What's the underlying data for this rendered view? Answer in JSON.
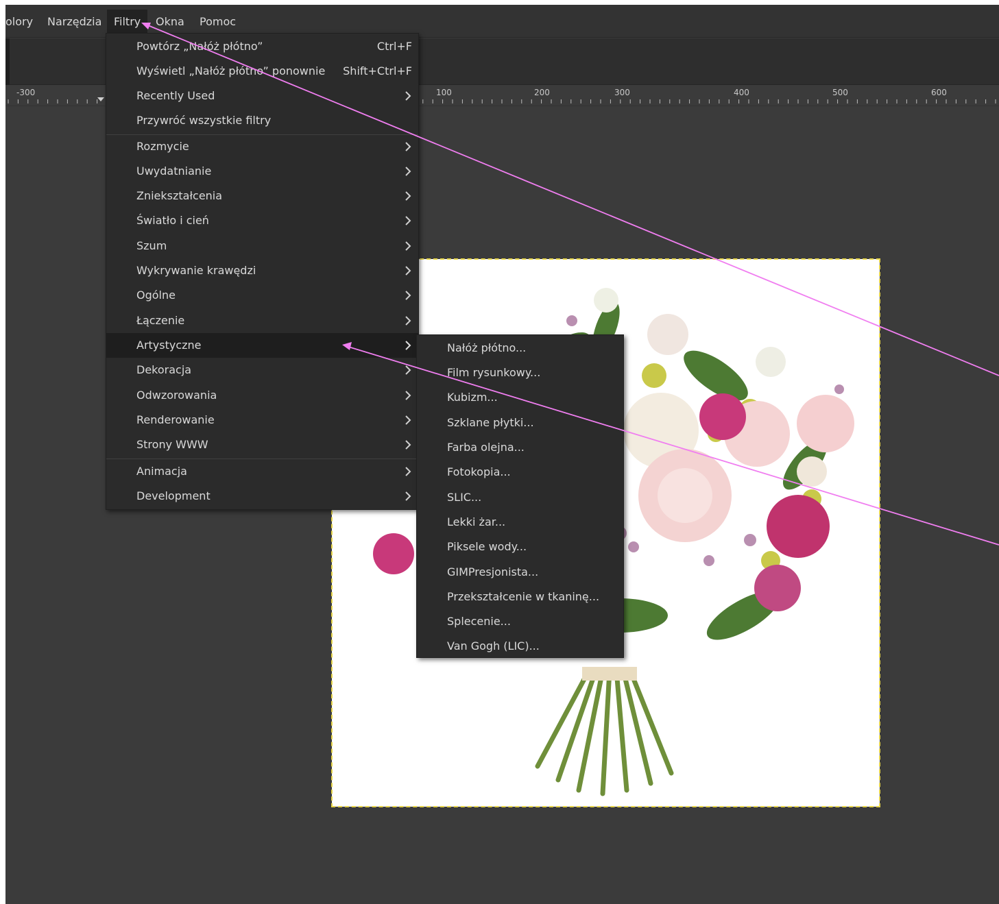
{
  "menubar": {
    "items": [
      "olory",
      "Narzędzia",
      "Filtry",
      "Okna",
      "Pomoc"
    ]
  },
  "ruler": {
    "labels": [
      "-300",
      "100",
      "200",
      "300",
      "400",
      "500",
      "600"
    ]
  },
  "filters_menu": {
    "items": [
      {
        "label": "Powtórz „Nałóż płótno”",
        "shortcut": "Ctrl+F"
      },
      {
        "label": "Wyświetl „Nałóż płótno” ponownie",
        "shortcut": "Shift+Ctrl+F"
      },
      {
        "label": "Recently Used",
        "submenu": true
      },
      {
        "label": "Przywróć wszystkie filtry"
      },
      {
        "label": "Rozmycie",
        "submenu": true
      },
      {
        "label": "Uwydatnianie",
        "submenu": true
      },
      {
        "label": "Zniekształcenia",
        "submenu": true
      },
      {
        "label": "Światło i cień",
        "submenu": true
      },
      {
        "label": "Szum",
        "submenu": true
      },
      {
        "label": "Wykrywanie krawędzi",
        "submenu": true
      },
      {
        "label": "Ogólne",
        "submenu": true
      },
      {
        "label": "Łączenie",
        "submenu": true
      },
      {
        "label": "Artystyczne",
        "submenu": true,
        "active": true
      },
      {
        "label": "Dekoracja",
        "submenu": true
      },
      {
        "label": "Odwzorowania",
        "submenu": true
      },
      {
        "label": "Renderowanie",
        "submenu": true
      },
      {
        "label": "Strony WWW",
        "submenu": true
      },
      {
        "label": "Animacja",
        "submenu": true
      },
      {
        "label": "Development",
        "submenu": true
      }
    ]
  },
  "artistic_submenu": {
    "items": [
      "Nałóż płótno...",
      "Film rysunkowy...",
      "Kubizm...",
      "Szklane płytki...",
      "Farba olejna...",
      "Fotokopia...",
      "SLIC...",
      "Lekki żar...",
      "Piksele wody...",
      "GIMPresjonista...",
      "Przekształcenie w tkaninę...",
      "Splecenie...",
      "Van Gogh (LIC)..."
    ]
  },
  "colors": {
    "background": "#3b3b3b",
    "menu_bg": "#2b2b2b",
    "menu_active": "#1e1e1e",
    "annotation": "#f07ef0",
    "selection_border": "#e8d64a"
  }
}
